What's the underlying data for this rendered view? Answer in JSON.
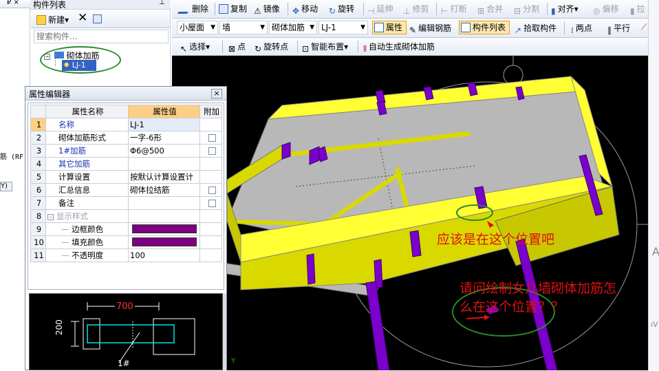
{
  "left_toolbar": {
    "pin_label": "₽ ×"
  },
  "component_panel": {
    "title": "构件列表",
    "new_label": "新建",
    "search_placeholder": "搜索构件...",
    "tree": {
      "group": "砌体加筋",
      "item": "LJ-1"
    }
  },
  "toolbar1": {
    "delete": "删除",
    "copy": "复制",
    "mirror": "镜像",
    "move": "移动",
    "rotate": "旋转",
    "extend": "延伸",
    "trim": "修剪",
    "break": "打断",
    "merge": "合并",
    "split": "分割",
    "align": "对齐",
    "offset": "偏移",
    "stretch": "拉"
  },
  "toolbar2": {
    "floor": "小屋面",
    "type": "墙",
    "subtype": "砌体加筋",
    "component": "LJ-1",
    "properties": "属性",
    "edit_rebar": "编辑钢筋",
    "component_list": "构件列表",
    "pick": "拾取构件",
    "two_points": "两点",
    "parallel": "平行"
  },
  "toolbar3": {
    "select": "选择",
    "point": "点",
    "rotate_point": "旋转点",
    "smart_layout": "智能布置",
    "auto_generate": "自动生成砌体加筋"
  },
  "left_fragments": {
    "a": "筋 (RF",
    "b": "Y)"
  },
  "property_editor": {
    "title": "属性编辑器",
    "close": "×",
    "headers": {
      "name": "属性名称",
      "value": "属性值",
      "extra": "附加"
    },
    "rows": [
      {
        "n": "1",
        "name": "名称",
        "value": "LJ-1"
      },
      {
        "n": "2",
        "name": "砌体加筋形式",
        "value": "一字-6形"
      },
      {
        "n": "3",
        "name": "1#加筋",
        "value": "Φ6@500"
      },
      {
        "n": "4",
        "name": "其它加筋",
        "value": ""
      },
      {
        "n": "5",
        "name": "计算设置",
        "value": "按默认计算设置计"
      },
      {
        "n": "6",
        "name": "汇总信息",
        "value": "砌体拉结筋"
      },
      {
        "n": "7",
        "name": "备注",
        "value": ""
      },
      {
        "n": "8",
        "name": "显示样式",
        "value": ""
      },
      {
        "n": "9",
        "name": "边框颜色",
        "value": ""
      },
      {
        "n": "10",
        "name": "填充颜色",
        "value": ""
      },
      {
        "n": "11",
        "name": "不透明度",
        "value": "100"
      }
    ],
    "preview": {
      "dim_700": "700",
      "dim_200": "200",
      "label_1": "1#"
    }
  },
  "annotations": {
    "note1": "应该是在这个位置吧",
    "note2_line1": "请问绘制女儿墙砌体加筋怎",
    "note2_line2": "么在这个位置？？"
  },
  "right_fragments": {
    "a": "A",
    "b": "ıV"
  },
  "colors": {
    "wall": "#d9d900",
    "slab": "#b8b8b8",
    "column": "#7a00cc",
    "annotation": "#e01010",
    "highlight": "#2a8a2a"
  }
}
